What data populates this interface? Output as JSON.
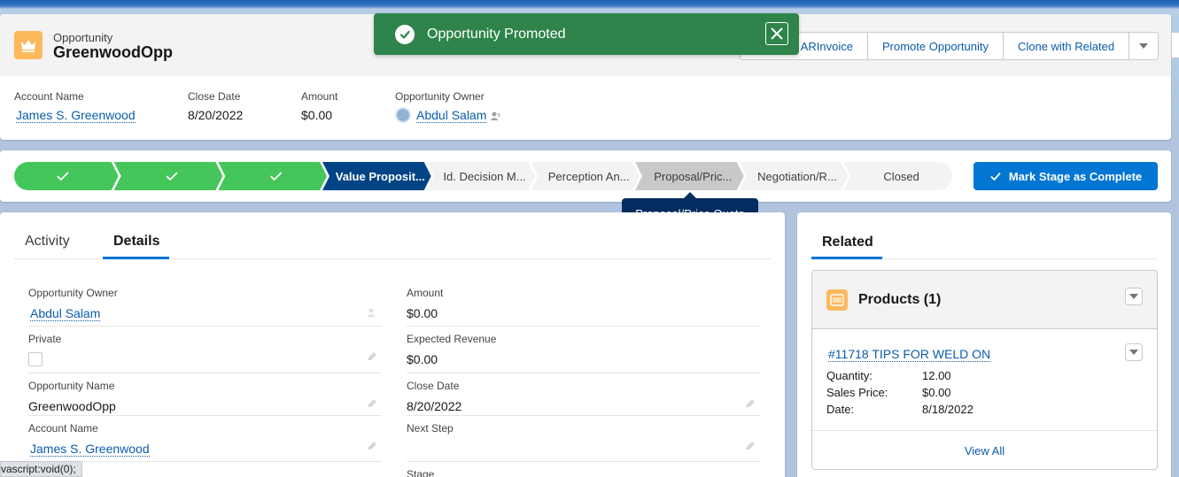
{
  "header": {
    "record_type": "Opportunity",
    "record_name": "GreenwoodOpp",
    "actions": [
      "ARInvoice",
      "Promote Opportunity",
      "Clone with Related"
    ],
    "fields": [
      {
        "label": "Account Name",
        "value": "James S. Greenwood"
      },
      {
        "label": "Close Date",
        "value": "8/20/2022"
      },
      {
        "label": "Amount",
        "value": "$0.00"
      },
      {
        "label": "Opportunity Owner",
        "value": "Abdul Salam"
      }
    ]
  },
  "toast": {
    "message": "Opportunity Promoted",
    "color": "#2e844a"
  },
  "path": {
    "stages": [
      {
        "label": "",
        "state": "complete"
      },
      {
        "label": "",
        "state": "complete"
      },
      {
        "label": "",
        "state": "complete"
      },
      {
        "label": "Value Proposit...",
        "state": "current"
      },
      {
        "label": "Id. Decision M...",
        "state": "incomplete"
      },
      {
        "label": "Perception An...",
        "state": "incomplete"
      },
      {
        "label": "Proposal/Pric...",
        "state": "hover"
      },
      {
        "label": "Negotiation/R...",
        "state": "incomplete"
      },
      {
        "label": "Closed",
        "state": "incomplete"
      }
    ],
    "tooltip": "Proposal/Price Quote",
    "mark_complete": "Mark Stage as Complete",
    "colors": {
      "complete": "#45c65a",
      "current": "#014486",
      "incomplete": "#f3f3f3",
      "hover": "#c9c9c9"
    }
  },
  "tabs": {
    "activity": "Activity",
    "details": "Details"
  },
  "details": {
    "opportunity_owner": {
      "label": "Opportunity Owner",
      "value": "Abdul Salam"
    },
    "amount": {
      "label": "Amount",
      "value": "$0.00"
    },
    "private": {
      "label": "Private"
    },
    "expected_revenue": {
      "label": "Expected Revenue",
      "value": "$0.00"
    },
    "opportunity_name": {
      "label": "Opportunity Name",
      "value": "GreenwoodOpp"
    },
    "close_date": {
      "label": "Close Date",
      "value": "8/20/2022"
    },
    "account_name": {
      "label": "Account Name",
      "value": "James S. Greenwood"
    },
    "next_step": {
      "label": "Next Step",
      "value": ""
    },
    "stage": {
      "label": "Stage"
    }
  },
  "related": {
    "tab": "Related",
    "products": {
      "title": "Products (1)",
      "item": {
        "name": "#11718 TIPS FOR WELD ON",
        "quantity_label": "Quantity:",
        "quantity": "12.00",
        "sales_price_label": "Sales Price:",
        "sales_price": "$0.00",
        "date_label": "Date:",
        "date": "8/18/2022"
      },
      "view_all": "View All"
    }
  },
  "status_bar": "vascript:void(0);"
}
